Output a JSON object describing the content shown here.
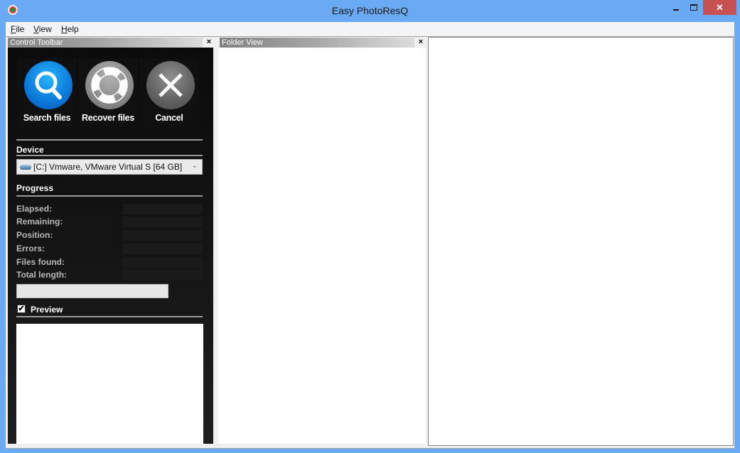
{
  "window": {
    "title": "Easy PhotoResQ",
    "controls": {
      "minimize": "minimize",
      "maximize": "maximize",
      "close": "✕"
    }
  },
  "menu": [
    {
      "label": "File",
      "mnemonic": "F",
      "rest": "ile"
    },
    {
      "label": "View",
      "mnemonic": "V",
      "rest": "iew"
    },
    {
      "label": "Help",
      "mnemonic": "H",
      "rest": "elp"
    }
  ],
  "control_toolbar": {
    "title": "Control Toolbar",
    "close": "×",
    "buttons": [
      {
        "label": "Search files",
        "icon": "search-icon"
      },
      {
        "label": "Recover files",
        "icon": "lifebuoy-icon"
      },
      {
        "label": "Cancel",
        "icon": "cancel-x-icon"
      }
    ],
    "device": {
      "heading": "Device",
      "selected": "[C:] Vmware, VMware Virtual S [64 GB]"
    },
    "progress": {
      "heading": "Progress",
      "fields": [
        {
          "label": "Elapsed:",
          "value": ""
        },
        {
          "label": "Remaining:",
          "value": ""
        },
        {
          "label": "Position:",
          "value": ""
        },
        {
          "label": "Errors:",
          "value": ""
        },
        {
          "label": "Files found:",
          "value": ""
        },
        {
          "label": "Total length:",
          "value": ""
        }
      ],
      "percent": 0
    },
    "preview": {
      "label": "Preview",
      "checked": true,
      "check_glyph": "✔"
    }
  },
  "folder_view": {
    "title": "Folder View",
    "close": "×"
  }
}
